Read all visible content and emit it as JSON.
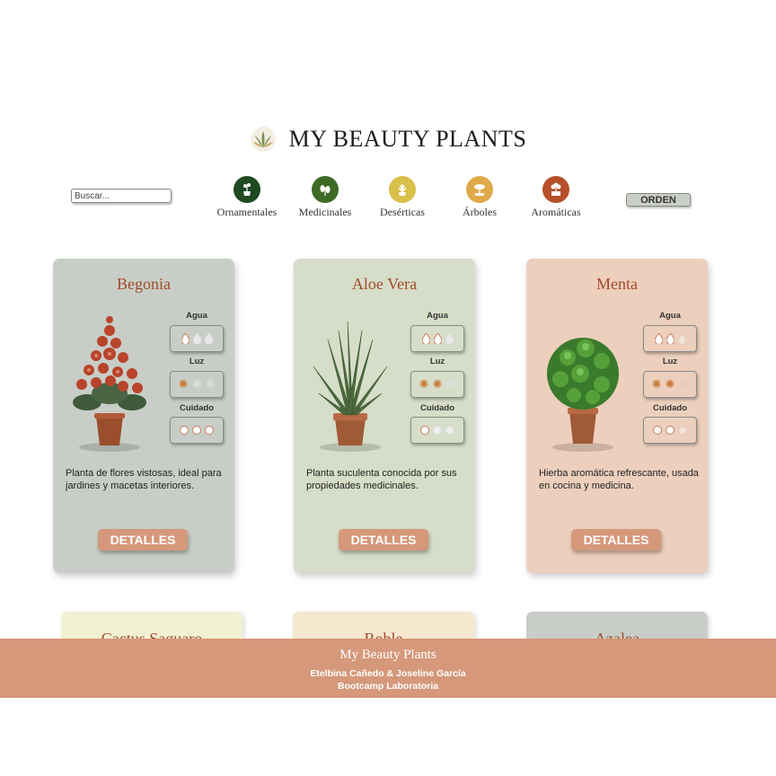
{
  "header": {
    "title": "MY BEAUTY PLANTS",
    "logo_icon": "aloe-leaf-icon"
  },
  "search": {
    "placeholder": "Buscar..."
  },
  "categories": [
    {
      "label": "Ornamentales",
      "icon": "potted-plant-icon",
      "color": "#1f4a22"
    },
    {
      "label": "Medicinales",
      "icon": "herb-leaf-icon",
      "color": "#3d6b26"
    },
    {
      "label": "Desérticas",
      "icon": "succulent-icon",
      "color": "#d9c04a"
    },
    {
      "label": "Árboles",
      "icon": "bonsai-icon",
      "color": "#e0a94a"
    },
    {
      "label": "Aromáticas",
      "icon": "aromatic-bush-icon",
      "color": "#b5502a"
    }
  ],
  "order_button": {
    "label": "ORDEN"
  },
  "meter_labels": {
    "water": "Agua",
    "light": "Luz",
    "care": "Cuidado"
  },
  "cards": [
    {
      "name": "Begonia",
      "description": "Planta de flores vistosas, ideal para jardines y macetas interiores.",
      "bg": "#c8cec7",
      "water": 1,
      "light": 1,
      "care": 3,
      "button": "DETALLES",
      "image": "begonia-plant"
    },
    {
      "name": "Aloe Vera",
      "description": "Planta suculenta conocida por sus propiedades medicinales.",
      "bg": "#d6ddc8",
      "water": 2,
      "light": 2,
      "care": 1,
      "button": "DETALLES",
      "image": "aloe-plant"
    },
    {
      "name": "Menta",
      "description": "Hierba aromática refrescante, usada en cocina y medicina.",
      "bg": "#edcfbd",
      "water": 2,
      "light": 2,
      "care": 2,
      "button": "DETALLES",
      "image": "mint-plant"
    }
  ],
  "cards_row2": [
    {
      "name": "Cactus Saguaro",
      "bg": "#f1f1d2"
    },
    {
      "name": "Roble",
      "bg": "#f6e7cf"
    },
    {
      "name": "Azalea",
      "bg": "#c8cec7"
    }
  ],
  "footer": {
    "title": "My Beauty Plants",
    "authors": "Etelbina Cañedo & Joseline García",
    "program": "Bootcamp Laboratoria"
  },
  "colors": {
    "accent": "#d5987a",
    "title": "#a04a2a"
  }
}
